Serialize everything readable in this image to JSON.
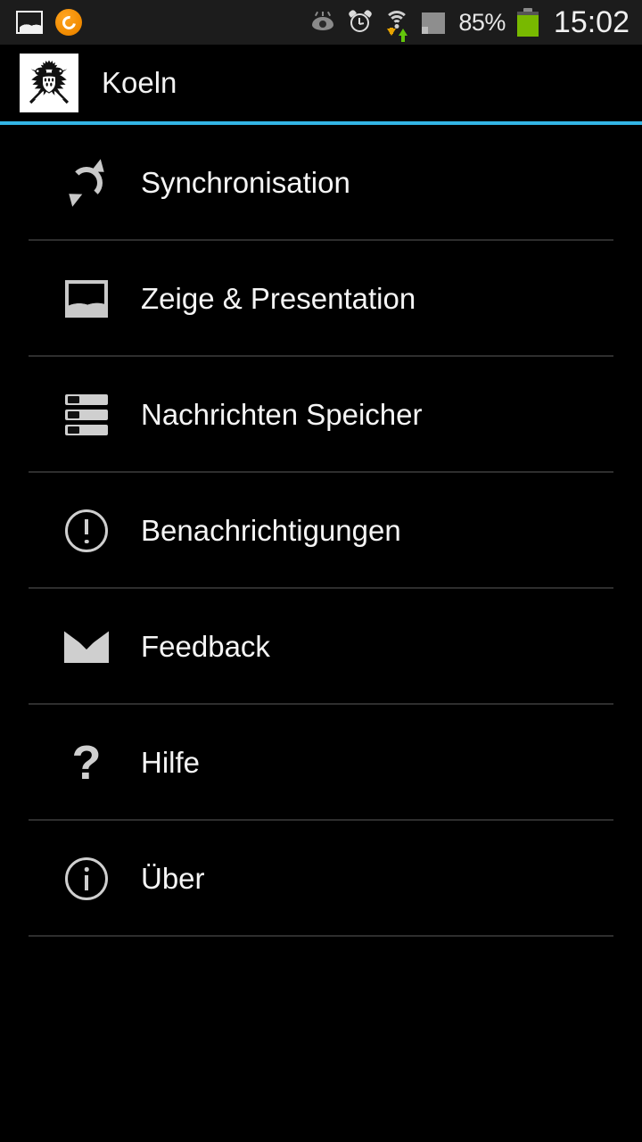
{
  "colors": {
    "background": "#000000",
    "status_bar_bg": "#1c1c1c",
    "accent": "#33b5e5",
    "divider": "#2e2e2e",
    "text": "#f5f5f5",
    "icon": "#cfcfcf",
    "battery_green": "#78b900",
    "download_arrow": "#e8a400",
    "upload_arrow": "#63c60b",
    "app_orange": "#f08a00"
  },
  "status_bar": {
    "left_icons": [
      {
        "name": "screenshot-gallery-icon"
      },
      {
        "name": "app-notification-icon"
      }
    ],
    "right_icons": [
      {
        "name": "smart-stay-eye-icon"
      },
      {
        "name": "alarm-clock-icon"
      },
      {
        "name": "wifi-data-transfer-icon"
      },
      {
        "name": "cellular-signal-icon"
      }
    ],
    "battery_percent": "85%",
    "clock": "15:02"
  },
  "app_bar": {
    "logo_name": "koeln-coat-of-arms-logo",
    "title": "Koeln"
  },
  "settings_list": {
    "items": [
      {
        "label": "Synchronisation",
        "icon": "sync-icon"
      },
      {
        "label": "Zeige & Presentation",
        "icon": "image-icon"
      },
      {
        "label": "Nachrichten Speicher",
        "icon": "storage-icon"
      },
      {
        "label": "Benachrichtigungen",
        "icon": "alert-circle-icon"
      },
      {
        "label": "Feedback",
        "icon": "mail-envelope-icon"
      },
      {
        "label": "Hilfe",
        "icon": "question-mark-icon"
      },
      {
        "label": "Über",
        "icon": "info-circle-icon"
      }
    ]
  }
}
